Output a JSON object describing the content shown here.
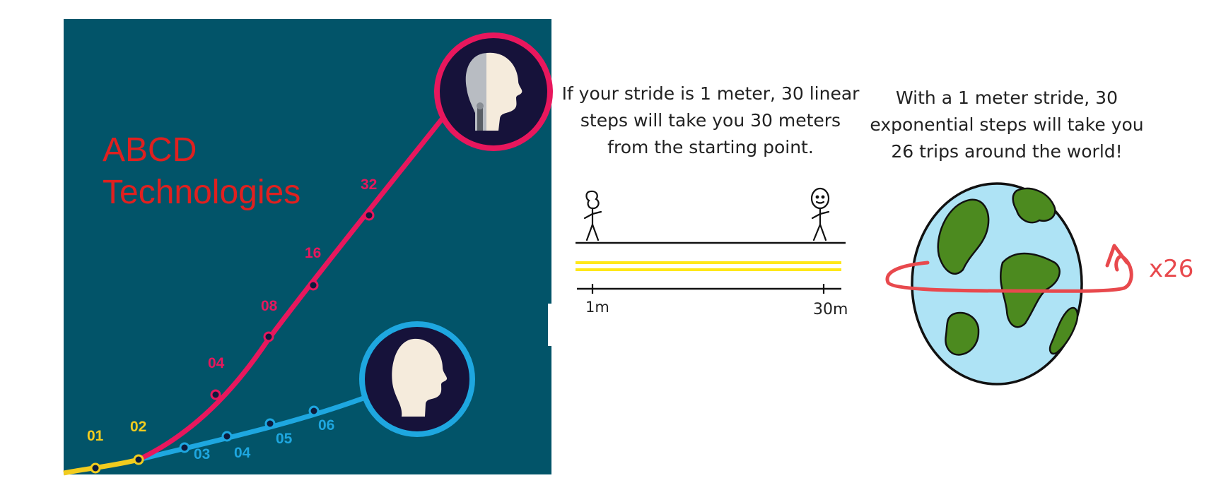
{
  "left_panel": {
    "background": "#025469",
    "brand_line1": "ABCD",
    "brand_line2": "Technologies",
    "brand_color": "#e0201f",
    "red_series_color": "#e8175d",
    "blue_series_color": "#1ea7e0",
    "yellow_series_color": "#f2cc1e",
    "start_labels": [
      "01",
      "02"
    ],
    "exponential_labels": [
      "04",
      "08",
      "16",
      "32"
    ],
    "linear_labels": [
      "03",
      "04",
      "05",
      "06"
    ],
    "robot_icon": "robot-head-icon",
    "human_icon": "human-head-icon"
  },
  "linear_panel": {
    "caption_lines": [
      "If your stride is 1 meter, 30 linear",
      "steps will take you 30 meters",
      "from the starting point."
    ],
    "scale_start": "1m",
    "scale_end": "30m"
  },
  "exponential_panel": {
    "caption_lines": [
      "With a 1 meter stride, 30",
      "exponential steps will take you",
      "26 trips around the world!"
    ],
    "multiplier": "x26",
    "globe_icon": "globe-icon"
  }
}
